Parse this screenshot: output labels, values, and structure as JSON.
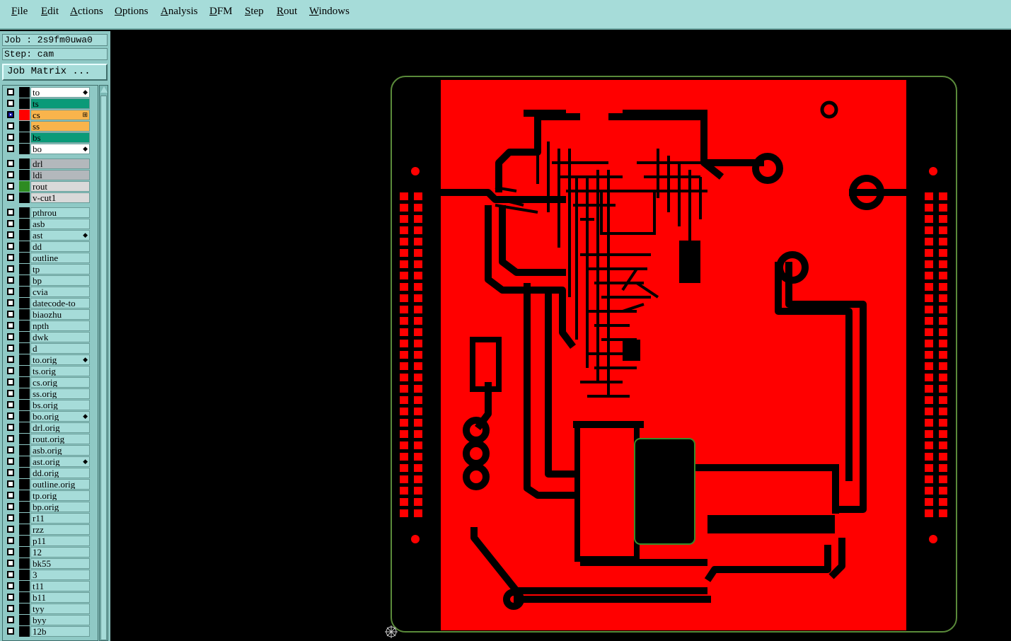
{
  "menu": [
    "File",
    "Edit",
    "Actions",
    "Options",
    "Analysis",
    "DFM",
    "Step",
    "Rout",
    "Windows"
  ],
  "job_line": "Job : 2s9fm0uwa0",
  "step_line": "Step: cam",
  "job_matrix_button": "Job Matrix ...",
  "colors": {
    "board_fill": "#ff0000",
    "outline": "#5a8a3a",
    "panel": "#8fc9c5",
    "teal": "#0a9a78",
    "orange": "#f9b44c",
    "grey": "#b3b8bc"
  },
  "layers": [
    {
      "name": "to",
      "swatch": "#000000",
      "bg": "#ffffff",
      "mark": "◆",
      "checked": false,
      "group": 0
    },
    {
      "name": "ts",
      "swatch": "#000000",
      "bg": "#0a9a78",
      "mark": "",
      "checked": false,
      "group": 0
    },
    {
      "name": "cs",
      "swatch": "#ff0000",
      "bg": "#f9b44c",
      "mark": "⊞",
      "checked": true,
      "group": 0
    },
    {
      "name": "ss",
      "swatch": "#000000",
      "bg": "#f9b44c",
      "mark": "",
      "checked": false,
      "group": 0
    },
    {
      "name": "bs",
      "swatch": "#000000",
      "bg": "#0a9a78",
      "mark": "",
      "checked": false,
      "group": 0
    },
    {
      "name": "bo",
      "swatch": "#000000",
      "bg": "#ffffff",
      "mark": "◆",
      "checked": false,
      "group": 0
    },
    {
      "name": "drl",
      "swatch": "#000000",
      "bg": "#b3b8bc",
      "mark": "",
      "checked": false,
      "group": 1
    },
    {
      "name": "ldi",
      "swatch": "#000000",
      "bg": "#b3b8bc",
      "mark": "",
      "checked": false,
      "group": 1
    },
    {
      "name": "rout",
      "swatch": "#2e8b22",
      "bg": "#d9d9d9",
      "mark": "",
      "checked": false,
      "group": 1
    },
    {
      "name": "v-cut1",
      "swatch": "#000000",
      "bg": "#d9d9d9",
      "mark": "",
      "checked": false,
      "group": 1
    },
    {
      "name": "pthrou",
      "swatch": "#000000",
      "bg": "#a6dcd9",
      "mark": "",
      "checked": false,
      "group": 2
    },
    {
      "name": "asb",
      "swatch": "#000000",
      "bg": "#a6dcd9",
      "mark": "",
      "checked": false,
      "group": 2
    },
    {
      "name": "ast",
      "swatch": "#000000",
      "bg": "#a6dcd9",
      "mark": "◆",
      "checked": false,
      "group": 2
    },
    {
      "name": "dd",
      "swatch": "#000000",
      "bg": "#a6dcd9",
      "mark": "",
      "checked": false,
      "group": 2
    },
    {
      "name": "outline",
      "swatch": "#000000",
      "bg": "#a6dcd9",
      "mark": "",
      "checked": false,
      "group": 2
    },
    {
      "name": "tp",
      "swatch": "#000000",
      "bg": "#a6dcd9",
      "mark": "",
      "checked": false,
      "group": 2
    },
    {
      "name": "bp",
      "swatch": "#000000",
      "bg": "#a6dcd9",
      "mark": "",
      "checked": false,
      "group": 2
    },
    {
      "name": "cvia",
      "swatch": "#000000",
      "bg": "#a6dcd9",
      "mark": "",
      "checked": false,
      "group": 2
    },
    {
      "name": "datecode-to",
      "swatch": "#000000",
      "bg": "#a6dcd9",
      "mark": "",
      "checked": false,
      "group": 2
    },
    {
      "name": "biaozhu",
      "swatch": "#000000",
      "bg": "#a6dcd9",
      "mark": "",
      "checked": false,
      "group": 2
    },
    {
      "name": "npth",
      "swatch": "#000000",
      "bg": "#a6dcd9",
      "mark": "",
      "checked": false,
      "group": 2
    },
    {
      "name": "dwk",
      "swatch": "#000000",
      "bg": "#a6dcd9",
      "mark": "",
      "checked": false,
      "group": 2
    },
    {
      "name": "d",
      "swatch": "#000000",
      "bg": "#a6dcd9",
      "mark": "",
      "checked": false,
      "group": 2
    },
    {
      "name": "to.orig",
      "swatch": "#000000",
      "bg": "#a6dcd9",
      "mark": "◆",
      "checked": false,
      "group": 2
    },
    {
      "name": "ts.orig",
      "swatch": "#000000",
      "bg": "#a6dcd9",
      "mark": "",
      "checked": false,
      "group": 2
    },
    {
      "name": "cs.orig",
      "swatch": "#000000",
      "bg": "#a6dcd9",
      "mark": "",
      "checked": false,
      "group": 2
    },
    {
      "name": "ss.orig",
      "swatch": "#000000",
      "bg": "#a6dcd9",
      "mark": "",
      "checked": false,
      "group": 2
    },
    {
      "name": "bs.orig",
      "swatch": "#000000",
      "bg": "#a6dcd9",
      "mark": "",
      "checked": false,
      "group": 2
    },
    {
      "name": "bo.orig",
      "swatch": "#000000",
      "bg": "#a6dcd9",
      "mark": "◆",
      "checked": false,
      "group": 2
    },
    {
      "name": "drl.orig",
      "swatch": "#000000",
      "bg": "#a6dcd9",
      "mark": "",
      "checked": false,
      "group": 2
    },
    {
      "name": "rout.orig",
      "swatch": "#000000",
      "bg": "#a6dcd9",
      "mark": "",
      "checked": false,
      "group": 2
    },
    {
      "name": "asb.orig",
      "swatch": "#000000",
      "bg": "#a6dcd9",
      "mark": "",
      "checked": false,
      "group": 2
    },
    {
      "name": "ast.orig",
      "swatch": "#000000",
      "bg": "#a6dcd9",
      "mark": "◆",
      "checked": false,
      "group": 2
    },
    {
      "name": "dd.orig",
      "swatch": "#000000",
      "bg": "#a6dcd9",
      "mark": "",
      "checked": false,
      "group": 2
    },
    {
      "name": "outline.orig",
      "swatch": "#000000",
      "bg": "#a6dcd9",
      "mark": "",
      "checked": false,
      "group": 2
    },
    {
      "name": "tp.orig",
      "swatch": "#000000",
      "bg": "#a6dcd9",
      "mark": "",
      "checked": false,
      "group": 2
    },
    {
      "name": "bp.orig",
      "swatch": "#000000",
      "bg": "#a6dcd9",
      "mark": "",
      "checked": false,
      "group": 2
    },
    {
      "name": "r11",
      "swatch": "#000000",
      "bg": "#a6dcd9",
      "mark": "",
      "checked": false,
      "group": 2
    },
    {
      "name": "rzz",
      "swatch": "#000000",
      "bg": "#a6dcd9",
      "mark": "",
      "checked": false,
      "group": 2
    },
    {
      "name": "p11",
      "swatch": "#000000",
      "bg": "#a6dcd9",
      "mark": "",
      "checked": false,
      "group": 2
    },
    {
      "name": "12",
      "swatch": "#000000",
      "bg": "#a6dcd9",
      "mark": "",
      "checked": false,
      "group": 2
    },
    {
      "name": "bk55",
      "swatch": "#000000",
      "bg": "#a6dcd9",
      "mark": "",
      "checked": false,
      "group": 2
    },
    {
      "name": "3",
      "swatch": "#000000",
      "bg": "#a6dcd9",
      "mark": "",
      "checked": false,
      "group": 2
    },
    {
      "name": "t11",
      "swatch": "#000000",
      "bg": "#a6dcd9",
      "mark": "",
      "checked": false,
      "group": 2
    },
    {
      "name": "b11",
      "swatch": "#000000",
      "bg": "#a6dcd9",
      "mark": "",
      "checked": false,
      "group": 2
    },
    {
      "name": "tyy",
      "swatch": "#000000",
      "bg": "#a6dcd9",
      "mark": "",
      "checked": false,
      "group": 2
    },
    {
      "name": "byy",
      "swatch": "#000000",
      "bg": "#a6dcd9",
      "mark": "",
      "checked": false,
      "group": 2
    },
    {
      "name": "12b",
      "swatch": "#000000",
      "bg": "#a6dcd9",
      "mark": "",
      "checked": false,
      "group": 2
    }
  ]
}
